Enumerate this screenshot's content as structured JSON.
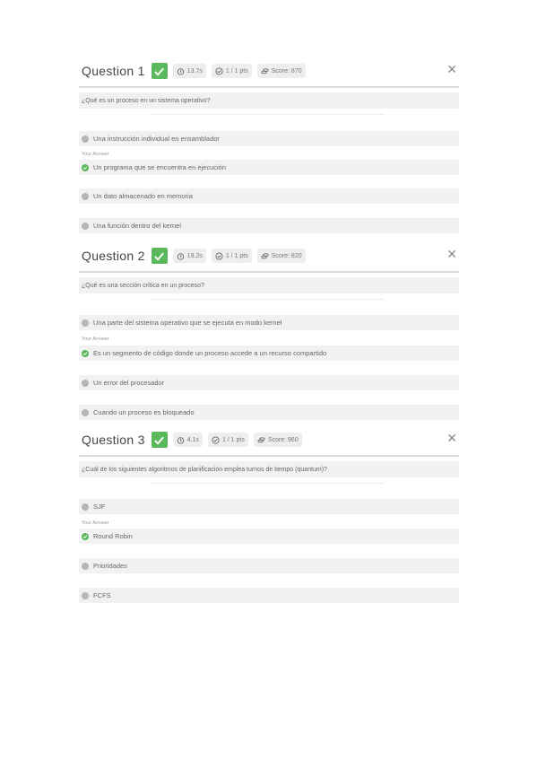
{
  "your_answer_label": "Your Answer",
  "questions": [
    {
      "title": "Question 1",
      "time": "13.7s",
      "points": "1 / 1 pts",
      "score": "Score: 870",
      "prompt": "¿Qué es un proceso en un sistema operativo?",
      "answers": [
        "Una instrucción individual en ensamblador",
        "Un programa que se encuentra en ejecución",
        "Un dato almacenado en memoria",
        "Una función dentro del kernel"
      ],
      "selected_index": 1
    },
    {
      "title": "Question 2",
      "time": "19.2s",
      "points": "1 / 1 pts",
      "score": "Score: 820",
      "prompt": "¿Qué es una sección crítica en un proceso?",
      "answers": [
        "Una parte del sistema operativo que se ejecuta en modo kernel",
        "Es un segmento de código donde un proceso accede a un recurso compartido",
        "Un error del procesador",
        "Cuando un proceso es bloqueado"
      ],
      "selected_index": 1
    },
    {
      "title": "Question 3",
      "time": "4.1s",
      "points": "1 / 1 pts",
      "score": "Score: 960",
      "prompt": "¿Cuál de los siguientes algoritmos de planificación emplea turnos de tiempo (quantum)?",
      "answers": [
        "SJF",
        "Round Robin",
        "Prioridades",
        "FCFS"
      ],
      "selected_index": 1
    }
  ],
  "colors": {
    "correct": "#5cb85c",
    "panel": "#f1f1f1",
    "chip": "#eeeeee"
  }
}
